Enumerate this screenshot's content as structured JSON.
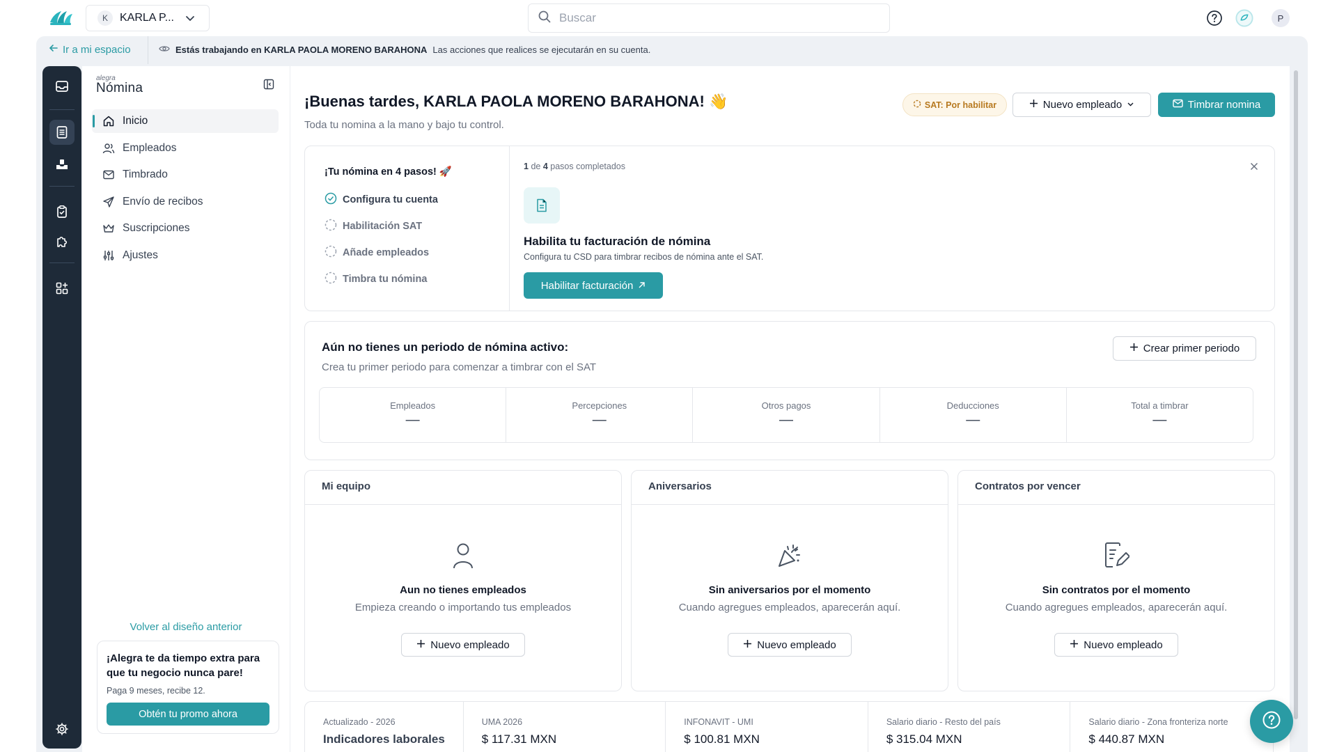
{
  "topbar": {
    "account_initial": "K",
    "account_name": "KARLA P...",
    "search_placeholder": "Buscar",
    "user_initial": "P",
    "icons": [
      "help-icon",
      "assistant-icon"
    ]
  },
  "banner": {
    "back_label": "Ir a mi espacio",
    "working_bold": "Estás trabajando en KARLA PAOLA MORENO BARAHONA",
    "working_rest": "Las acciones que realices se ejecutarán en su cuenta."
  },
  "rail": {
    "icons": [
      "inbox-icon",
      "payroll-icon",
      "inbox-tray-icon",
      "clipboard-icon",
      "puzzle-icon",
      "apps-icon",
      "settings-icon"
    ]
  },
  "sidebar": {
    "brand_small": "alegra",
    "brand_big": "Nómina",
    "items": [
      {
        "label": "Inicio",
        "icon": "home-icon",
        "active": true
      },
      {
        "label": "Empleados",
        "icon": "users-icon",
        "active": false
      },
      {
        "label": "Timbrado",
        "icon": "mail-icon",
        "active": false
      },
      {
        "label": "Envío de recibos",
        "icon": "send-icon",
        "active": false
      },
      {
        "label": "Suscripciones",
        "icon": "crown-icon",
        "active": false
      },
      {
        "label": "Ajustes",
        "icon": "sliders-icon",
        "active": false
      }
    ],
    "back_old_design": "Volver al diseño anterior",
    "promo": {
      "title": "¡Alegra te da tiempo extra para que tu negocio nunca pare!",
      "subtitle": "Paga 9 meses, recibe 12.",
      "button": "Obtén tu promo ahora"
    }
  },
  "main": {
    "greeting": "¡Buenas tardes, KARLA PAOLA MORENO BARAHONA! 👋",
    "subtitle": "Toda tu nomina a la mano y bajo tu control.",
    "sat_badge": "SAT: Por habilitar",
    "new_employee_button": "Nuevo empleado",
    "stamp_button": "Timbrar nomina",
    "steps": {
      "title": "¡Tu nómina en 4 pasos! 🚀",
      "items": [
        {
          "label": "Configura tu cuenta",
          "done": true
        },
        {
          "label": "Habilitación SAT",
          "done": false
        },
        {
          "label": "Añade empleados",
          "done": false
        },
        {
          "label": "Timbra tu nómina",
          "done": false
        }
      ],
      "progress_done": "1",
      "progress_total": "4",
      "progress_of": "de",
      "progress_text": "pasos completados",
      "current_title": "Habilita tu facturación de nómina",
      "current_desc": "Configura tu CSD para timbrar recibos de nómina ante el SAT.",
      "current_button": "Habilitar facturación"
    },
    "period": {
      "title": "Aún no tienes un periodo de nómina activo:",
      "desc": "Crea tu primer periodo para comenzar a timbrar con el SAT",
      "button": "Crear primer periodo",
      "stats": [
        {
          "label": "Empleados",
          "value": "—"
        },
        {
          "label": "Percepciones",
          "value": "—"
        },
        {
          "label": "Otros pagos",
          "value": "—"
        },
        {
          "label": "Deducciones",
          "value": "—"
        },
        {
          "label": "Total a timbrar",
          "value": "—"
        }
      ]
    },
    "widgets": [
      {
        "title": "Mi equipo",
        "heading": "Aun no tienes empleados",
        "desc": "Empieza creando o importando tus empleados",
        "button": "Nuevo empleado",
        "icon": "user-icon"
      },
      {
        "title": "Aniversarios",
        "heading": "Sin aniversarios por el momento",
        "desc": "Cuando agregues empleados, aparecerán aquí.",
        "button": "Nuevo empleado",
        "icon": "party-popper-icon"
      },
      {
        "title": "Contratos por vencer",
        "heading": "Sin contratos por el momento",
        "desc": "Cuando agregues empleados, aparecerán aquí.",
        "button": "Nuevo empleado",
        "icon": "contract-edit-icon"
      }
    ],
    "indicators": {
      "updated_label": "Actualizado - 2026",
      "title": "Indicadores laborales",
      "items": [
        {
          "label": "UMA 2026",
          "value": "$ 117.31 MXN"
        },
        {
          "label": "INFONAVIT - UMI",
          "value": "$ 100.81 MXN"
        },
        {
          "label": "Salario diario - Resto del país",
          "value": "$ 315.04 MXN"
        },
        {
          "label": "Salario diario - Zona fronteriza norte",
          "value": "$ 440.87 MXN"
        }
      ]
    }
  },
  "colors": {
    "accent": "#2a9ba4",
    "rail_bg": "#1e2a38",
    "frame_bg": "#eef1f5",
    "sat_badge": "#b7791f"
  }
}
